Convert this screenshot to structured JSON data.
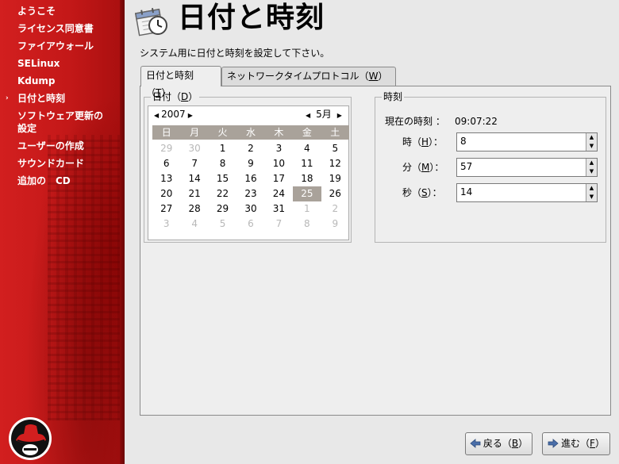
{
  "sidebar": {
    "items": [
      {
        "label": "ようこそ"
      },
      {
        "label": "ライセンス同意書"
      },
      {
        "label": "ファイアウォール"
      },
      {
        "label": "SELinux"
      },
      {
        "label": "Kdump"
      },
      {
        "label": "日付と時刻",
        "current": true
      },
      {
        "label": "ソフトウェア更新の"
      },
      {
        "label": "設定"
      },
      {
        "label": "ユーザーの作成"
      },
      {
        "label": "サウンドカード"
      },
      {
        "label": "追加の　CD"
      }
    ],
    "current_marker": "›"
  },
  "header": {
    "title": "日付と時刻",
    "instruction": "システム用に日付と時刻を設定して下さい。"
  },
  "tabs": [
    {
      "label": "日付と時刻（",
      "mnemonic": "T",
      "suffix": "）",
      "active": true
    },
    {
      "label": "ネットワークタイムプロトコル（",
      "mnemonic": "W",
      "suffix": "）",
      "active": false
    }
  ],
  "date": {
    "frame_label": "日付（",
    "frame_mnemonic": "D",
    "frame_suffix": "）",
    "year": "2007",
    "month": "5月",
    "weekdays": [
      "日",
      "月",
      "火",
      "水",
      "木",
      "金",
      "土"
    ],
    "days": [
      [
        "29",
        "30",
        "1",
        "2",
        "3",
        "4",
        "5"
      ],
      [
        "6",
        "7",
        "8",
        "9",
        "10",
        "11",
        "12"
      ],
      [
        "13",
        "14",
        "15",
        "16",
        "17",
        "18",
        "19"
      ],
      [
        "20",
        "21",
        "22",
        "23",
        "24",
        "25",
        "26"
      ],
      [
        "27",
        "28",
        "29",
        "30",
        "31",
        "1",
        "2"
      ],
      [
        "3",
        "4",
        "5",
        "6",
        "7",
        "8",
        "9"
      ]
    ],
    "selected_day": "25"
  },
  "time": {
    "frame_label": "時刻",
    "current_label": "現在の時刻 ：",
    "current_value": "09:07:22",
    "hour_label": "時（",
    "hour_mnemonic": "H",
    "hour_suffix": "）：",
    "hour_value": "8",
    "minute_label": "分（",
    "minute_mnemonic": "M",
    "minute_suffix": "）：",
    "minute_value": "57",
    "second_label": "秒（",
    "second_mnemonic": "S",
    "second_suffix": "）：",
    "second_value": "14"
  },
  "buttons": {
    "back_label": "戻る（",
    "back_mnemonic": "B",
    "back_suffix": "）",
    "next_label": "進む（",
    "next_mnemonic": "F",
    "next_suffix": "）"
  },
  "colors": {
    "sidebar_red": "#c41818",
    "calendar_header": "#a9a29a",
    "selected_day": "#a9a29a"
  },
  "icons": {
    "header": "calendar-clock-icon",
    "back": "arrow-left-icon",
    "next": "arrow-right-icon",
    "logo": "red-hat-logo"
  }
}
